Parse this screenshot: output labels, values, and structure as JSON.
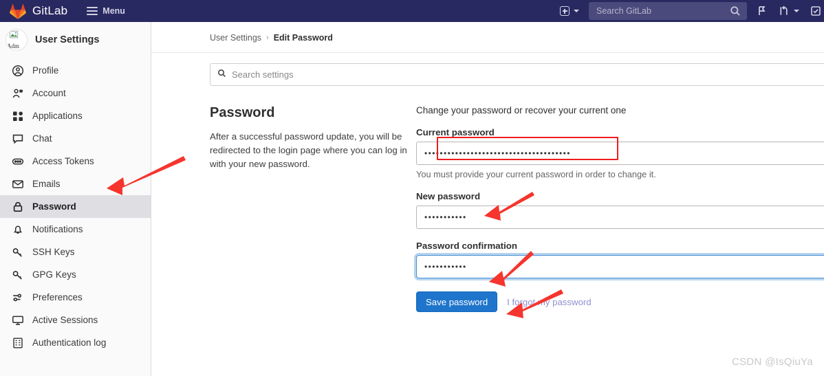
{
  "navbar": {
    "brand": "GitLab",
    "menu_label": "Menu",
    "logo_icon": "gitlab-tanuki-logo",
    "create_icon": "plus-square-icon",
    "create_chevron_icon": "chevron-down-icon",
    "search": {
      "placeholder": "Search GitLab",
      "icon": "search-icon"
    },
    "issues_icon": "issues-icon",
    "merge_requests_icon": "merge-request-icon",
    "merge_requests_chevron_icon": "chevron-down-icon",
    "todos_icon": "todo-list-icon",
    "right_chevron_icon": "chevron-down-icon"
  },
  "sidebar": {
    "title": "User Settings",
    "avatar_alt": "Adm",
    "avatar_icon": "broken-image-icon",
    "items": [
      {
        "label": "Profile",
        "icon": "user-circle-icon",
        "active": false
      },
      {
        "label": "Account",
        "icon": "user-settings-icon",
        "active": false
      },
      {
        "label": "Applications",
        "icon": "applications-icon",
        "active": false
      },
      {
        "label": "Chat",
        "icon": "chat-bubble-icon",
        "active": false
      },
      {
        "label": "Access Tokens",
        "icon": "token-icon",
        "active": false
      },
      {
        "label": "Emails",
        "icon": "envelope-icon",
        "active": false
      },
      {
        "label": "Password",
        "icon": "lock-icon",
        "active": true
      },
      {
        "label": "Notifications",
        "icon": "bell-icon",
        "active": false
      },
      {
        "label": "SSH Keys",
        "icon": "key-icon",
        "active": false
      },
      {
        "label": "GPG Keys",
        "icon": "key-icon",
        "active": false
      },
      {
        "label": "Preferences",
        "icon": "sliders-icon",
        "active": false
      },
      {
        "label": "Active Sessions",
        "icon": "monitor-icon",
        "active": false
      },
      {
        "label": "Authentication log",
        "icon": "log-list-icon",
        "active": false
      }
    ]
  },
  "breadcrumb": {
    "root": "User Settings",
    "separator": "›",
    "current": "Edit Password"
  },
  "settings_search": {
    "placeholder": "Search settings",
    "icon": "search-icon",
    "value": ""
  },
  "panel": {
    "title": "Password",
    "description": "After a successful password update, you will be redirected to the login page where you can log in with your new password."
  },
  "form": {
    "legend": "Change your password or recover your current one",
    "current_password": {
      "label": "Current password",
      "value": "••••••••••••••••••••••••••••••••••••••",
      "help": "You must provide your current password in order to change it."
    },
    "new_password": {
      "label": "New password",
      "value": "•••••••••••"
    },
    "password_confirmation": {
      "label": "Password confirmation",
      "value": "•••••••••••"
    },
    "save_button": "Save password",
    "forgot_link": "I forgot my password"
  },
  "watermark": "CSDN @IsQiuYa",
  "colors": {
    "navbar_bg": "#292961",
    "navbar_search_bg": "#4a4a7c",
    "sidebar_bg": "#fafafa",
    "sidebar_active_bg": "#dedee3",
    "primary_button": "#1f75cb",
    "annotation_red": "#f01c1c",
    "focus_ring": "#b6d4f0"
  }
}
